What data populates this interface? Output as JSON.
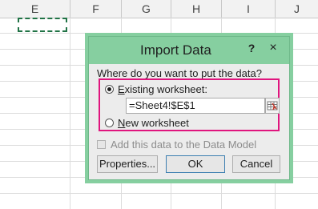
{
  "sheet": {
    "columns": [
      "E",
      "F",
      "G",
      "H",
      "I",
      "J"
    ]
  },
  "dialog": {
    "title": "Import Data",
    "help_label": "?",
    "close_label": "×",
    "prompt": "Where do you want to put the data?",
    "existing_worksheet": {
      "mnemonic": "E",
      "label_rest": "xisting worksheet:",
      "selected": true
    },
    "range_value": "=Sheet4!$E$1",
    "new_worksheet": {
      "mnemonic": "N",
      "label_rest": "ew worksheet",
      "selected": false
    },
    "data_model_label": "Add this data to the Data Model",
    "buttons": {
      "properties": "Properties...",
      "ok": "OK",
      "cancel": "Cancel"
    },
    "highlight_color": "#e0157e",
    "accent_color": "#86cfa0"
  }
}
